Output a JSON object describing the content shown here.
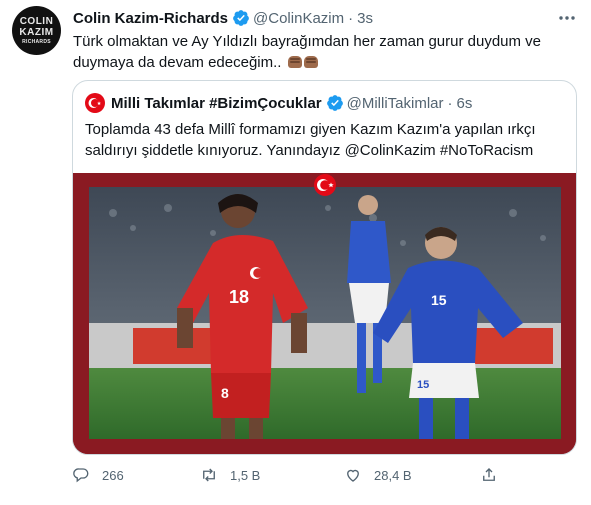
{
  "tweet": {
    "avatar": {
      "line1": "COLIN",
      "line2": "KAZIM",
      "line3": "RICHARDS"
    },
    "author_name": "Colin Kazim-Richards",
    "handle": "@ColinKazim",
    "separator": "·",
    "time": "3s",
    "text": "Türk olmaktan ve Ay Yıldızlı bayrağımdan her zaman gurur duydum ve duymaya da devam edeceğim..",
    "emoji": [
      "raised-fist-icon",
      "raised-fist-icon"
    ]
  },
  "quoted_tweet": {
    "author_name": "Milli Takımlar #BizimÇocuklar",
    "handle": "@MilliTakimlar",
    "separator": "·",
    "time": "6s",
    "text": "Toplamda 43 defa Millî formamızı giyen Kazım Kazım'a yapılan ırkçı saldırıyı şiddetle kınıyoruz. Yanındayız @ColinKazim #NoToRacism",
    "image": {
      "player_numbers": [
        "18",
        "8",
        "15",
        "15"
      ],
      "frame_color": "#8a1a22",
      "flag_color": "#e30a17"
    }
  },
  "actions": {
    "reply_count": "266",
    "retweet_count": "1,5 B",
    "like_count": "28,4 B"
  },
  "colors": {
    "verified": "#1d9bf0",
    "text": "#0f1419",
    "secondary": "#536471",
    "border": "#cfd9de"
  }
}
